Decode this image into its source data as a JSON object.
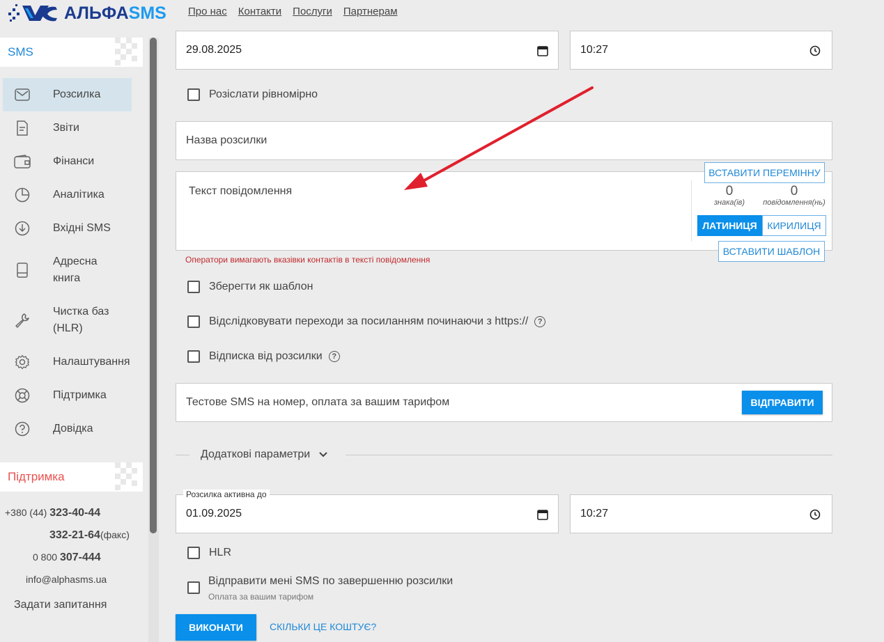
{
  "header": {
    "logo_text_a": "АЛЬФА",
    "logo_text_b": "SMS",
    "nav": [
      "Про нас",
      "Контакти",
      "Послуги",
      "Партнерам"
    ]
  },
  "sidebar": {
    "section_title": "SMS",
    "items": [
      {
        "label": "Розсилка",
        "icon": "envelope-icon"
      },
      {
        "label": "Звіти",
        "icon": "document-icon"
      },
      {
        "label": "Фінанси",
        "icon": "wallet-icon"
      },
      {
        "label": "Аналітика",
        "icon": "pie-chart-icon"
      },
      {
        "label": "Вхідні SMS",
        "icon": "incoming-icon"
      },
      {
        "label": "Адресна",
        "label2": "книга",
        "icon": "address-book-icon"
      },
      {
        "label": "Чистка баз",
        "label2": "(HLR)",
        "icon": "wrench-icon"
      },
      {
        "label": "Налаштування",
        "icon": "gear-icon"
      },
      {
        "label": "Підтримка",
        "icon": "lifebuoy-icon"
      },
      {
        "label": "Довідка",
        "icon": "question-icon"
      }
    ],
    "support_title": "Підтримка",
    "phone1_prefix": "+380 (44)",
    "phone1": "323-40-44",
    "phone2": "332-21-64",
    "phone2_suffix": "(факс)",
    "phone3_prefix": "0 800",
    "phone3": "307-444",
    "email": "info@alphasms.ua",
    "ask": "Задати запитання"
  },
  "form": {
    "start_date": "29.08.2025",
    "start_time": "10:27",
    "evenly_label": "Розіслати рівномірно",
    "name_placeholder": "Назва розсилки",
    "text_placeholder": "Текст повідомлення",
    "insert_variable": "ВСТАВИТИ ПЕРЕМІННУ",
    "chars_count": "0",
    "chars_label": "знака(ів)",
    "msgs_count": "0",
    "msgs_label": "повідомлення(нь)",
    "latin": "ЛАТИНИЦЯ",
    "cyrillic": "КИРИЛИЦЯ",
    "insert_template": "ВСТАВИТИ ШАБЛОН",
    "warning": "Оператори вимагають вказівки контактів в тексті повідомлення",
    "save_template": "Зберегти як шаблон",
    "track_links": "Відслідковувати переходи за посиланням починаючи з https://",
    "unsubscribe": "Відписка від розсилки",
    "test_sms_placeholder": "Тестове SMS на номер, оплата за вашим тарифом",
    "send": "ВІДПРАВИТИ",
    "extra_params": "Додаткові параметри",
    "active_until_label": "Розсилка активна до",
    "end_date": "01.09.2025",
    "end_time": "10:27",
    "hlr": "HLR",
    "notify_me": "Відправити мені SMS по завершенню розсилки",
    "notify_note": "Оплата за вашим тарифом",
    "execute": "ВИКОНАТИ",
    "cost": "СКІЛЬКИ ЦЕ КОШТУЄ?"
  },
  "colors": {
    "accent": "#0a8fea",
    "brand_dark": "#1a3b8f",
    "warning": "#c0292d",
    "arrow": "#e0202d",
    "support_title": "#e8524f"
  }
}
